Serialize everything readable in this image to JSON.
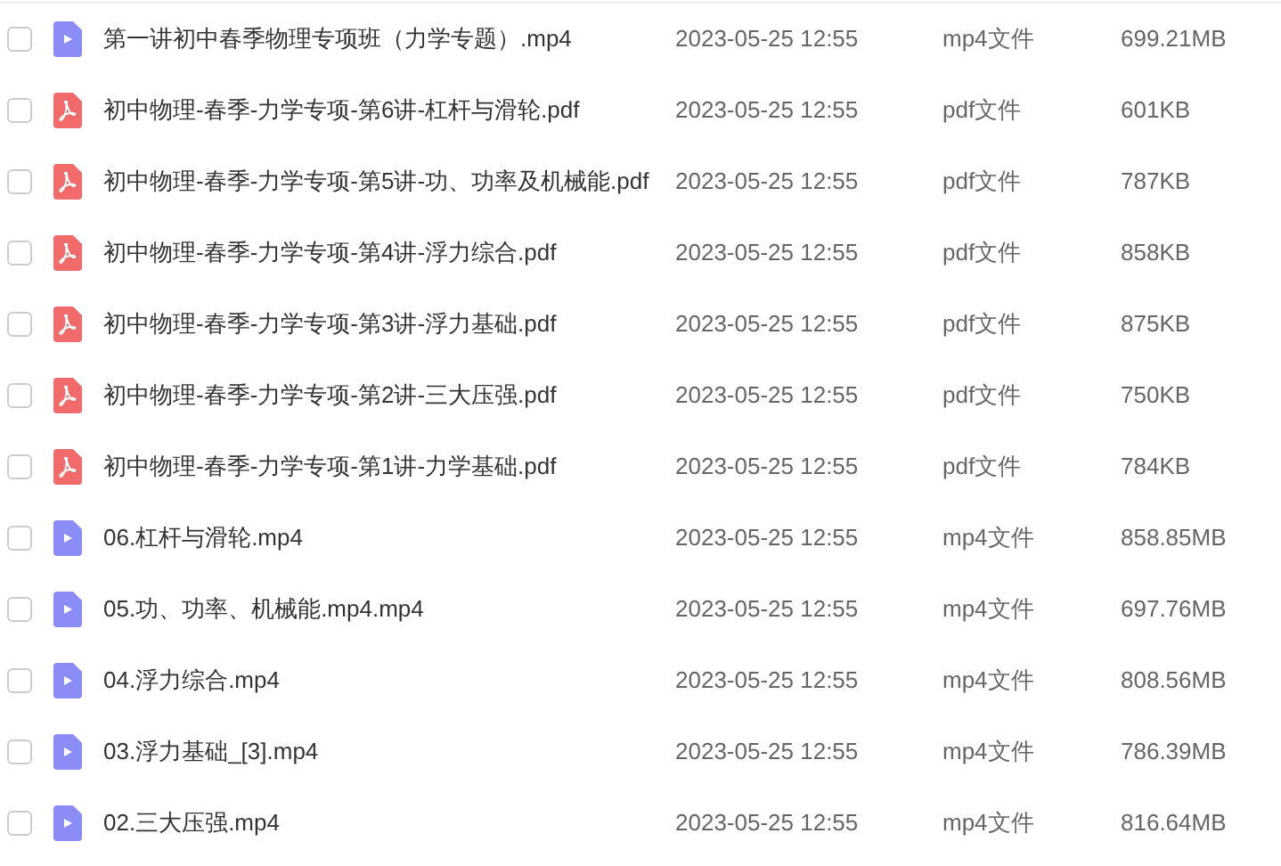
{
  "files": [
    {
      "kind": "video",
      "checked": false,
      "name": "第一讲初中春季物理专项班（力学专题）.mp4",
      "date": "2023-05-25 12:55",
      "type": "mp4文件",
      "size": "699.21MB"
    },
    {
      "kind": "pdf",
      "checked": false,
      "name": "初中物理-春季-力学专项-第6讲-杠杆与滑轮.pdf",
      "date": "2023-05-25 12:55",
      "type": "pdf文件",
      "size": "601KB"
    },
    {
      "kind": "pdf",
      "checked": false,
      "name": "初中物理-春季-力学专项-第5讲-功、功率及机械能.pdf",
      "date": "2023-05-25 12:55",
      "type": "pdf文件",
      "size": "787KB"
    },
    {
      "kind": "pdf",
      "checked": false,
      "name": "初中物理-春季-力学专项-第4讲-浮力综合.pdf",
      "date": "2023-05-25 12:55",
      "type": "pdf文件",
      "size": "858KB"
    },
    {
      "kind": "pdf",
      "checked": false,
      "name": "初中物理-春季-力学专项-第3讲-浮力基础.pdf",
      "date": "2023-05-25 12:55",
      "type": "pdf文件",
      "size": "875KB"
    },
    {
      "kind": "pdf",
      "checked": false,
      "name": "初中物理-春季-力学专项-第2讲-三大压强.pdf",
      "date": "2023-05-25 12:55",
      "type": "pdf文件",
      "size": "750KB"
    },
    {
      "kind": "pdf",
      "checked": false,
      "name": "初中物理-春季-力学专项-第1讲-力学基础.pdf",
      "date": "2023-05-25 12:55",
      "type": "pdf文件",
      "size": "784KB"
    },
    {
      "kind": "video",
      "checked": false,
      "name": "06.杠杆与滑轮.mp4",
      "date": "2023-05-25 12:55",
      "type": "mp4文件",
      "size": "858.85MB"
    },
    {
      "kind": "video",
      "checked": false,
      "name": "05.功、功率、机械能.mp4.mp4",
      "date": "2023-05-25 12:55",
      "type": "mp4文件",
      "size": "697.76MB"
    },
    {
      "kind": "video",
      "checked": false,
      "name": "04.浮力综合.mp4",
      "date": "2023-05-25 12:55",
      "type": "mp4文件",
      "size": "808.56MB"
    },
    {
      "kind": "video",
      "checked": false,
      "name": "03.浮力基础_[3].mp4",
      "date": "2023-05-25 12:55",
      "type": "mp4文件",
      "size": "786.39MB"
    },
    {
      "kind": "video",
      "checked": false,
      "name": "02.三大压强.mp4",
      "date": "2023-05-25 12:55",
      "type": "mp4文件",
      "size": "816.64MB"
    }
  ]
}
